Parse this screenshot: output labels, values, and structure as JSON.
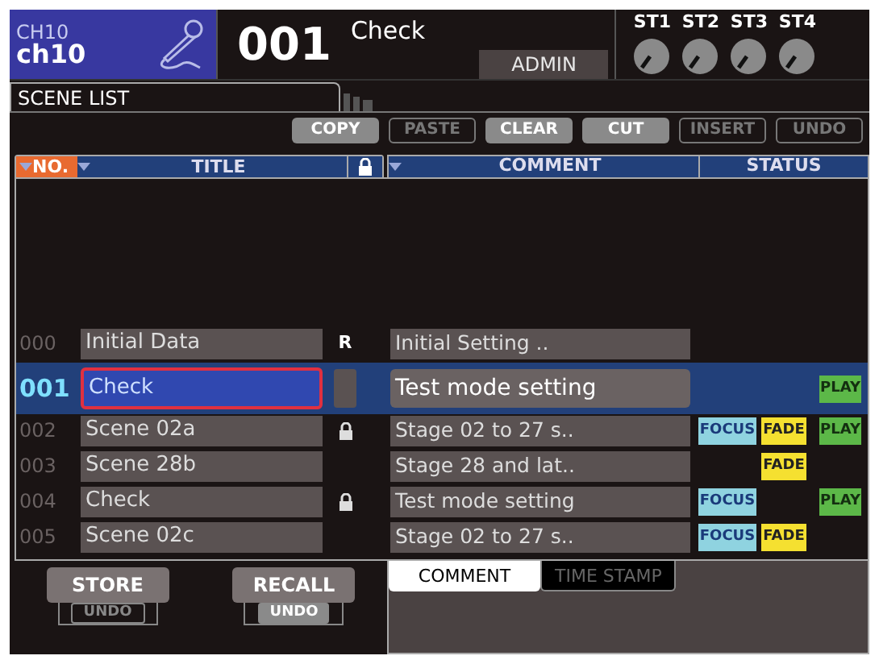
{
  "header": {
    "channel_id": "CH10",
    "channel_name": "ch10",
    "scene_number": "001",
    "scene_title": "Check",
    "user": "ADMIN",
    "knobs": [
      "ST1",
      "ST2",
      "ST3",
      "ST4"
    ]
  },
  "tabs": [
    {
      "label": "SCENE LIST",
      "selected": true
    }
  ],
  "toolbar": [
    {
      "label": "COPY",
      "disabled": false
    },
    {
      "label": "PASTE",
      "disabled": true
    },
    {
      "label": "CLEAR",
      "disabled": false
    },
    {
      "label": "CUT",
      "disabled": false
    },
    {
      "label": "INSERT",
      "disabled": true
    },
    {
      "label": "UNDO",
      "disabled": true
    }
  ],
  "left_columns": [
    {
      "label": "NO.",
      "sorted": true
    },
    {
      "label": "TITLE",
      "sorted": false
    }
  ],
  "right_columns": [
    {
      "label": "COMMENT"
    },
    {
      "label": "STATUS"
    }
  ],
  "scenes": [
    {
      "number": "000",
      "title": "Initial Data",
      "read_only": "R",
      "locked": false,
      "comment": "Initial Setting ..",
      "selected": false
    },
    {
      "number": "001",
      "title": "Check",
      "locked": false,
      "comment": "Test mode setting",
      "tags": [
        {
          "kind": "play",
          "label": "PLAY"
        }
      ],
      "selected": true
    },
    {
      "number": "002",
      "title": "Scene 02a",
      "locked": true,
      "comment": "Stage 02 to 27 s..",
      "tags": [
        {
          "kind": "focus",
          "label": "FOCUS"
        },
        {
          "kind": "fade",
          "label": "FADE"
        },
        {
          "kind": "play",
          "label": "PLAY"
        }
      ],
      "selected": false
    },
    {
      "number": "003",
      "title": "Scene 28b",
      "locked": false,
      "comment": "Stage 28 and lat..",
      "tags": [
        {
          "kind": "fade",
          "label": "FADE"
        }
      ],
      "selected": false
    },
    {
      "number": "004",
      "title": "Check",
      "locked": true,
      "comment": "Test mode setting",
      "tags": [
        {
          "kind": "focus",
          "label": "FOCUS"
        },
        {
          "kind": "play",
          "label": "PLAY"
        }
      ],
      "selected": false
    },
    {
      "number": "005",
      "title": "Scene 02c",
      "locked": false,
      "comment": "Stage 02 to 27 s..",
      "tags": [
        {
          "kind": "focus",
          "label": "FOCUS"
        },
        {
          "kind": "fade",
          "label": "FADE"
        }
      ],
      "selected": false
    }
  ],
  "actions": [
    {
      "label": "STORE",
      "undo": "UNDO",
      "undo_enabled": false
    },
    {
      "label": "RECALL",
      "undo": "UNDO",
      "undo_enabled": true
    }
  ],
  "detail_tabs": [
    {
      "label": "COMMENT",
      "selected": true
    },
    {
      "label": "TIME STAMP",
      "selected": false
    }
  ]
}
